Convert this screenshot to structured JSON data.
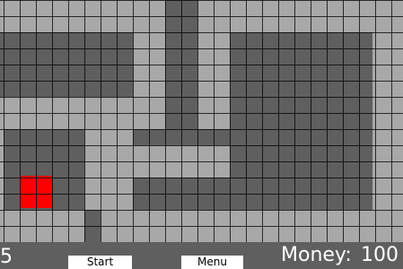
{
  "colors": {
    "track": "#a8a8a8",
    "ground": "#5f5f5f",
    "gridline": "#1a1a1a",
    "enemy": "#ff0000",
    "hud_text": "#ffffff",
    "button_bg": "#ffffff",
    "button_text": "#000000"
  },
  "hud": {
    "level_value": "5",
    "start_label": "Start",
    "menu_label": "Menu",
    "money_label": "Money:",
    "money_value": "100"
  }
}
